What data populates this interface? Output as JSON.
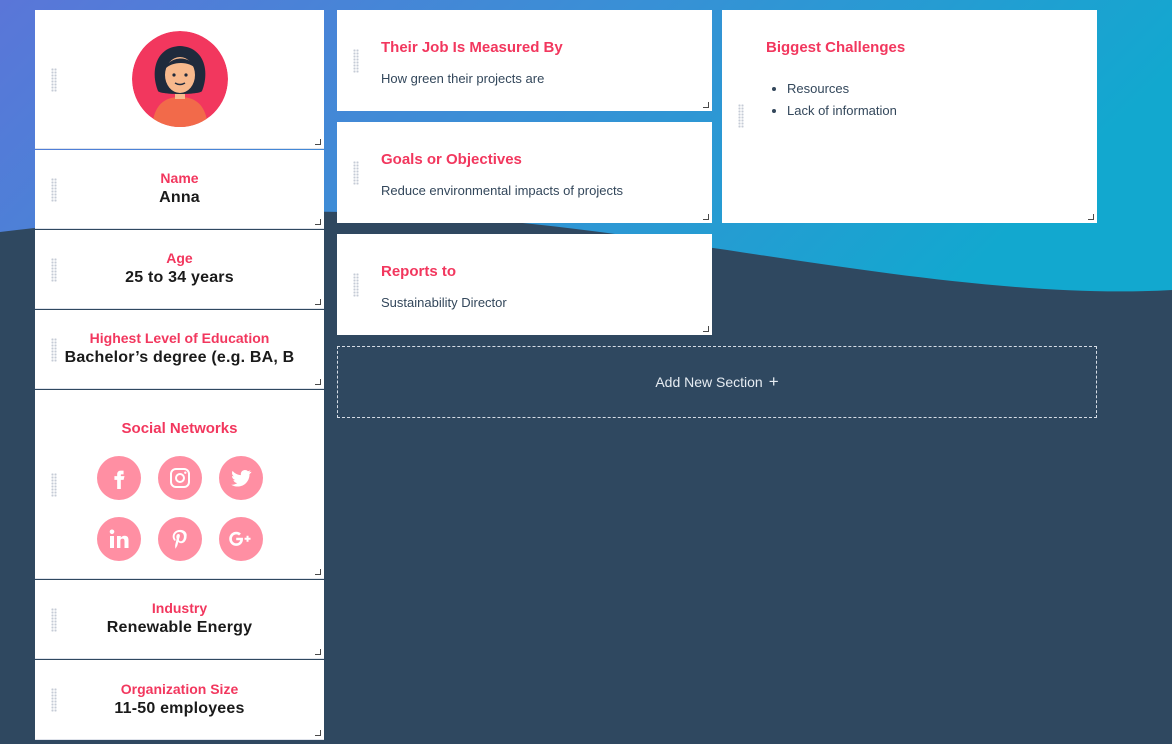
{
  "persona": {
    "avatar_icon": "avatar-illustration",
    "fields": [
      {
        "label": "Name",
        "value": "Anna"
      },
      {
        "label": "Age",
        "value": "25 to 34 years"
      },
      {
        "label": "Highest Level of Education",
        "value": "Bachelor’s degree (e.g. BA, B"
      }
    ],
    "social": {
      "title": "Social Networks",
      "icons": [
        "facebook-icon",
        "instagram-icon",
        "twitter-icon",
        "linkedin-icon",
        "pinterest-icon",
        "google-plus-icon"
      ]
    },
    "fields_lower": [
      {
        "label": "Industry",
        "value": "Renewable Energy"
      },
      {
        "label": "Organization Size",
        "value": "11-50 employees"
      }
    ]
  },
  "sections": [
    {
      "title": "Their Job Is Measured By",
      "text": "How green their projects are"
    },
    {
      "title": "Goals or Objectives",
      "text": "Reduce environmental impacts of projects"
    },
    {
      "title": "Reports to",
      "text": "Sustainability Director"
    }
  ],
  "challenges": {
    "title": "Biggest Challenges",
    "items": [
      "Resources",
      "Lack of information"
    ]
  },
  "add_section": {
    "label": "Add New Section",
    "icon": "plus-icon"
  },
  "colors": {
    "accent": "#f2375e",
    "social_bg": "#ff8fa3",
    "page_bg": "#2f4860"
  }
}
